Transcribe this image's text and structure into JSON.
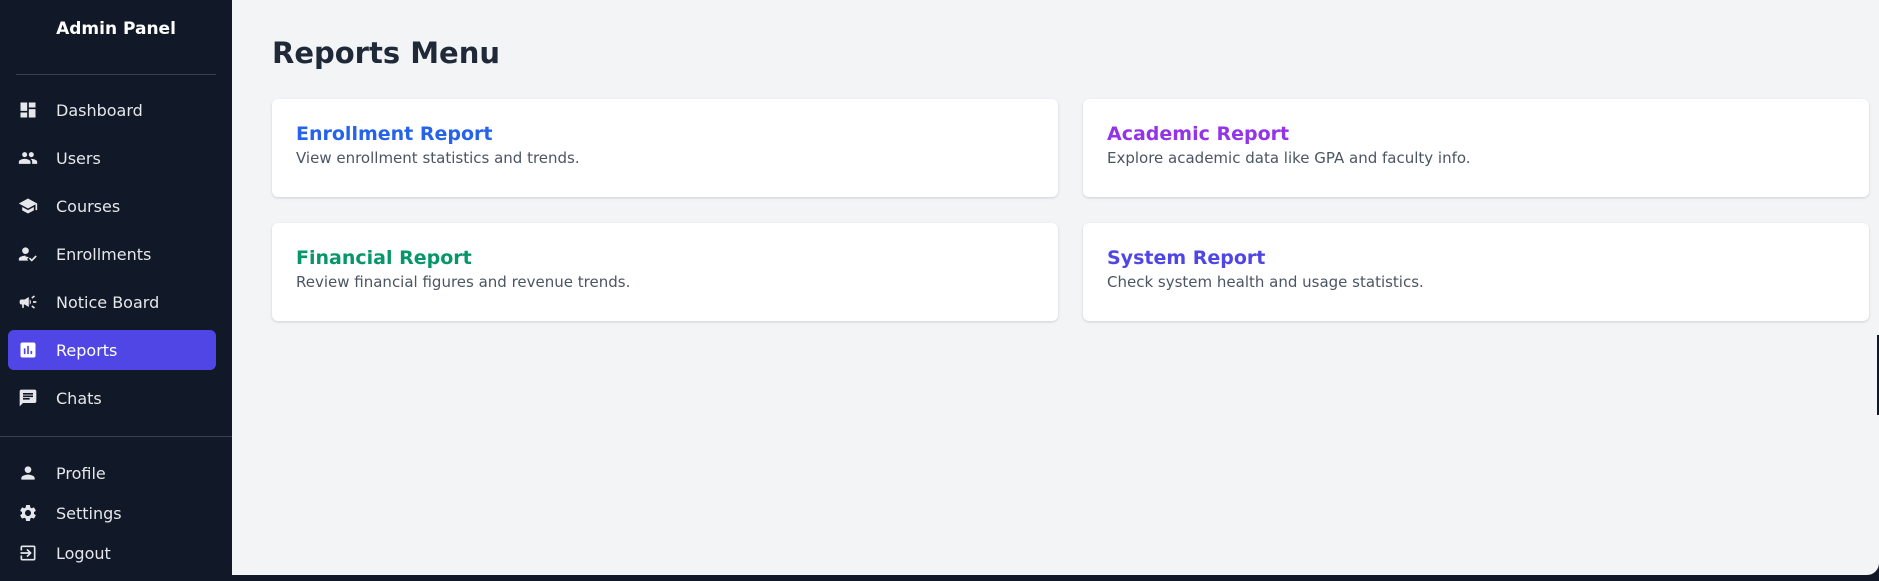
{
  "sidebar": {
    "brand": "Admin Panel",
    "items": [
      {
        "label": "Dashboard",
        "icon": "dashboard-icon",
        "active": false
      },
      {
        "label": "Users",
        "icon": "users-icon",
        "active": false
      },
      {
        "label": "Courses",
        "icon": "courses-icon",
        "active": false
      },
      {
        "label": "Enrollments",
        "icon": "enrollments-icon",
        "active": false
      },
      {
        "label": "Notice Board",
        "icon": "megaphone-icon",
        "active": false
      },
      {
        "label": "Reports",
        "icon": "reports-icon",
        "active": true
      },
      {
        "label": "Chats",
        "icon": "chat-icon",
        "active": false
      }
    ],
    "bottom_items": [
      {
        "label": "Profile",
        "icon": "profile-icon"
      },
      {
        "label": "Settings",
        "icon": "gear-icon"
      },
      {
        "label": "Logout",
        "icon": "logout-icon"
      }
    ]
  },
  "main": {
    "title": "Reports Menu",
    "cards": [
      {
        "title": "Enrollment Report",
        "description": "View enrollment statistics and trends.",
        "color": "#2563eb"
      },
      {
        "title": "Academic Report",
        "description": "Explore academic data like GPA and faculty info.",
        "color": "#9333ea"
      },
      {
        "title": "Financial Report",
        "description": "Review financial figures and revenue trends.",
        "color": "#059669"
      },
      {
        "title": "System Report",
        "description": "Check system health and usage statistics.",
        "color": "#4f46e5"
      }
    ]
  },
  "colors": {
    "sidebar_bg": "#111827",
    "active_bg": "#4f46e5",
    "main_bg": "#f3f4f6"
  }
}
